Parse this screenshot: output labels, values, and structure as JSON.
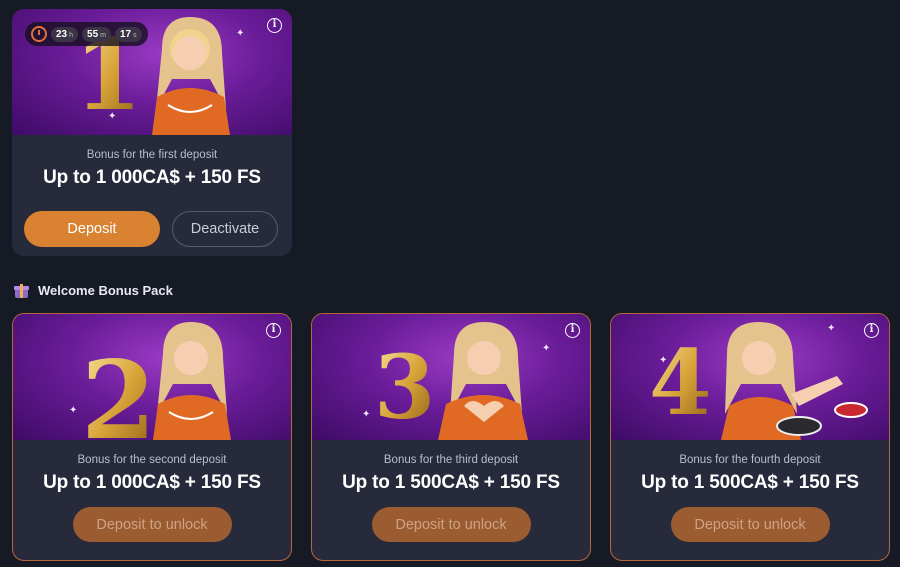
{
  "active_bonus": {
    "timer": {
      "hours": "23",
      "hours_unit": "h",
      "minutes": "55",
      "minutes_unit": "m",
      "seconds": "17",
      "seconds_unit": "s"
    },
    "number": "1",
    "subtitle": "Bonus for the first deposit",
    "amount": "Up to 1 000CA$ + 150 FS",
    "deposit_label": "Deposit",
    "deactivate_label": "Deactivate"
  },
  "pack": {
    "title": "Welcome Bonus Pack",
    "cards": [
      {
        "number": "2",
        "subtitle": "Bonus for the second deposit",
        "amount": "Up to 1 000CA$ + 150 FS",
        "button": "Deposit to unlock"
      },
      {
        "number": "3",
        "subtitle": "Bonus for the third deposit",
        "amount": "Up to 1 500CA$ + 150 FS",
        "button": "Deposit to unlock"
      },
      {
        "number": "4",
        "subtitle": "Bonus for the fourth deposit",
        "amount": "Up to 1 500CA$ + 150 FS",
        "button": "Deposit to unlock"
      }
    ]
  },
  "icons": {
    "info": "info-icon",
    "timer": "clock-icon",
    "gift": "gift-icon"
  },
  "colors": {
    "accent": "#d98232",
    "card_bg": "#262a3a",
    "page_bg": "#161a25",
    "outline": "#b4683a"
  }
}
